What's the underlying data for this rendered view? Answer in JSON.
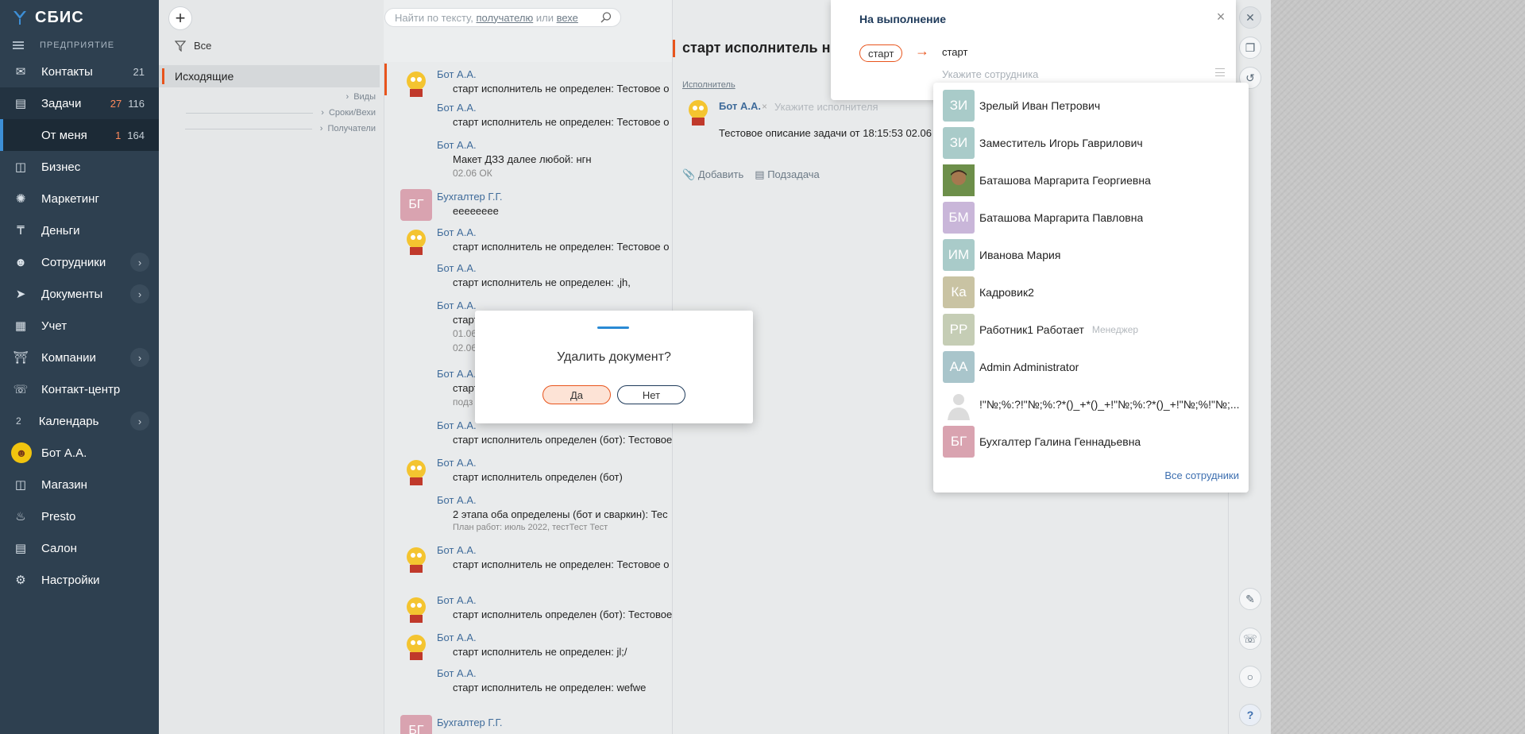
{
  "app": {
    "logo": "СБИС",
    "company": "ПРЕДПРИЯТИЕ"
  },
  "sidebar": {
    "items": [
      {
        "label": "Контакты",
        "icon": "contacts-icon",
        "count_gray": "21"
      },
      {
        "label": "Задачи",
        "icon": "tasks-icon",
        "count_red": "27",
        "count_gray": "116"
      },
      {
        "label": "От меня",
        "count_red": "1",
        "count_gray": "164"
      },
      {
        "label": "Бизнес",
        "icon": "business-icon"
      },
      {
        "label": "Маркетинг",
        "icon": "marketing-icon"
      },
      {
        "label": "Деньги",
        "icon": "money-icon"
      },
      {
        "label": "Сотрудники",
        "icon": "employees-icon"
      },
      {
        "label": "Документы",
        "icon": "documents-icon"
      },
      {
        "label": "Учет",
        "icon": "accounting-icon"
      },
      {
        "label": "Компании",
        "icon": "companies-icon"
      },
      {
        "label": "Контакт-центр",
        "icon": "headset-icon"
      },
      {
        "label": "Календарь",
        "num": "2"
      },
      {
        "label": "Бот А.А.",
        "icon": "user-avatar"
      },
      {
        "label": "Магазин",
        "icon": "shop-icon"
      },
      {
        "label": "Presto",
        "icon": "presto-icon"
      },
      {
        "label": "Салон",
        "icon": "salon-icon"
      },
      {
        "label": "Настройки",
        "icon": "gear-icon"
      }
    ]
  },
  "left_panel": {
    "filter": "Все",
    "folder": "Исходящие",
    "subfolders": [
      "Виды",
      "Сроки/Вехи",
      "Получатели"
    ]
  },
  "search": {
    "prefix": "Найти по тексту,",
    "link1": "получателю",
    "mid": "или",
    "link2": "вехе"
  },
  "feed": [
    {
      "author": "Бот А.А.",
      "text": "старт исполнитель не определен: Тестовое о"
    },
    {
      "author": "Бот А.А.",
      "text": "старт исполнитель не определен: Тестовое о"
    },
    {
      "author": "Бот А.А.",
      "text": "Макет ДЗЗ далее любой: нгн",
      "meta": "02.06 ОК"
    },
    {
      "author": "Бухгалтер Г.Г.",
      "avatar": "БГ",
      "text": "eeeeeeee"
    },
    {
      "author": "Бот А.А.",
      "text": "старт исполнитель не определен: Тестовое о"
    },
    {
      "author": "Бот А.А.",
      "text": "старт исполнитель не определен: ,jh,"
    },
    {
      "author": "Бот А.А.",
      "text": "старт",
      "meta": "01.06",
      "meta2": "02.06"
    },
    {
      "author": "Бот А.А.",
      "text": "старт",
      "meta": "подз"
    },
    {
      "author": "Бот А.А.",
      "text": "старт исполнитель определен (бот): Тестовое"
    },
    {
      "author": "Бот А.А.",
      "text": "старт исполнитель определен (бот)"
    },
    {
      "author": "Бот А.А.",
      "text": "2 этапа оба определены (бот и сваркин): Тес",
      "meta": "План работ: июль 2022, тестТест Тест"
    },
    {
      "author": "Бот А.А.",
      "text": "старт исполнитель не определен: Тестовое о"
    },
    {
      "author": "Бот А.А.",
      "text": "старт исполнитель определен (бот): Тестовое"
    },
    {
      "author": "Бот А.А.",
      "text": "старт исполнитель не определен: jl;/"
    },
    {
      "author": "Бот А.А.",
      "text": "старт исполнитель не определен: wefwe"
    },
    {
      "author": "Бухгалтер Г.Г.",
      "avatar": "БГ",
      "text": ""
    }
  ],
  "task": {
    "title": "старт исполнитель не",
    "executor_label": "Исполнитель",
    "executor_name": "Бот А.А.",
    "executor_placeholder": "Укажите исполнителя",
    "description": "Тестовое описание задачи от 18:15:53 02.06",
    "add_label": "Добавить",
    "subtask_label": "Подзадача"
  },
  "status_panel": {
    "title": "На выполнение",
    "from_chip": "старт",
    "to": "старт",
    "employee_placeholder": "Укажите сотрудника"
  },
  "employees": [
    {
      "initials": "ЗИ",
      "name": "Зрелый Иван Петрович",
      "color": "#a9cbc9"
    },
    {
      "initials": "ЗИ",
      "name": "Заместитель Игорь Гаврилович",
      "color": "#a9cbc9"
    },
    {
      "initials": "",
      "name": "Баташова Маргарита Георгиевна",
      "color": "#5a7a3a"
    },
    {
      "initials": "БМ",
      "name": "Баташова Маргарита Павловна",
      "color": "#c9b6d9"
    },
    {
      "initials": "ИМ",
      "name": "Иванова Мария",
      "color": "#a9cbc9"
    },
    {
      "initials": "Ка",
      "name": "Кадровик2",
      "color": "#c9c3a3"
    },
    {
      "initials": "РР",
      "name": "Работник1 Работает",
      "role": "Менеджер",
      "color": "#c5cdb5"
    },
    {
      "initials": "AA",
      "name": "Admin Administrator",
      "color": "#a9c5cb"
    },
    {
      "initials": "",
      "name": "!\"№;%:?!\"№;%:?*()_+*()_+!\"№;%:?*()_+!\"№;%!\"№;...",
      "color": "#dcdcdc"
    },
    {
      "initials": "БГ",
      "name": "Бухгалтер Галина Геннадьевна",
      "color": "#d9a3b0"
    }
  ],
  "all_employees_link": "Все сотрудники",
  "modal": {
    "question": "Удалить документ?",
    "yes": "Да",
    "no": "Нет"
  }
}
